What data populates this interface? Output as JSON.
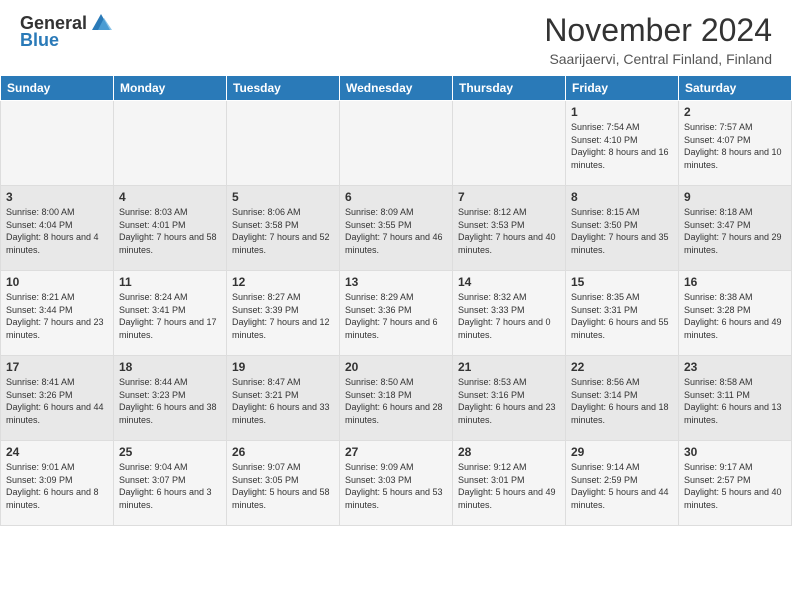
{
  "header": {
    "logo_general": "General",
    "logo_blue": "Blue",
    "month_title": "November 2024",
    "location": "Saarijaervi, Central Finland, Finland"
  },
  "weekdays": [
    "Sunday",
    "Monday",
    "Tuesday",
    "Wednesday",
    "Thursday",
    "Friday",
    "Saturday"
  ],
  "weeks": [
    [
      {
        "day": "",
        "info": ""
      },
      {
        "day": "",
        "info": ""
      },
      {
        "day": "",
        "info": ""
      },
      {
        "day": "",
        "info": ""
      },
      {
        "day": "",
        "info": ""
      },
      {
        "day": "1",
        "info": "Sunrise: 7:54 AM\nSunset: 4:10 PM\nDaylight: 8 hours and 16 minutes."
      },
      {
        "day": "2",
        "info": "Sunrise: 7:57 AM\nSunset: 4:07 PM\nDaylight: 8 hours and 10 minutes."
      }
    ],
    [
      {
        "day": "3",
        "info": "Sunrise: 8:00 AM\nSunset: 4:04 PM\nDaylight: 8 hours and 4 minutes."
      },
      {
        "day": "4",
        "info": "Sunrise: 8:03 AM\nSunset: 4:01 PM\nDaylight: 7 hours and 58 minutes."
      },
      {
        "day": "5",
        "info": "Sunrise: 8:06 AM\nSunset: 3:58 PM\nDaylight: 7 hours and 52 minutes."
      },
      {
        "day": "6",
        "info": "Sunrise: 8:09 AM\nSunset: 3:55 PM\nDaylight: 7 hours and 46 minutes."
      },
      {
        "day": "7",
        "info": "Sunrise: 8:12 AM\nSunset: 3:53 PM\nDaylight: 7 hours and 40 minutes."
      },
      {
        "day": "8",
        "info": "Sunrise: 8:15 AM\nSunset: 3:50 PM\nDaylight: 7 hours and 35 minutes."
      },
      {
        "day": "9",
        "info": "Sunrise: 8:18 AM\nSunset: 3:47 PM\nDaylight: 7 hours and 29 minutes."
      }
    ],
    [
      {
        "day": "10",
        "info": "Sunrise: 8:21 AM\nSunset: 3:44 PM\nDaylight: 7 hours and 23 minutes."
      },
      {
        "day": "11",
        "info": "Sunrise: 8:24 AM\nSunset: 3:41 PM\nDaylight: 7 hours and 17 minutes."
      },
      {
        "day": "12",
        "info": "Sunrise: 8:27 AM\nSunset: 3:39 PM\nDaylight: 7 hours and 12 minutes."
      },
      {
        "day": "13",
        "info": "Sunrise: 8:29 AM\nSunset: 3:36 PM\nDaylight: 7 hours and 6 minutes."
      },
      {
        "day": "14",
        "info": "Sunrise: 8:32 AM\nSunset: 3:33 PM\nDaylight: 7 hours and 0 minutes."
      },
      {
        "day": "15",
        "info": "Sunrise: 8:35 AM\nSunset: 3:31 PM\nDaylight: 6 hours and 55 minutes."
      },
      {
        "day": "16",
        "info": "Sunrise: 8:38 AM\nSunset: 3:28 PM\nDaylight: 6 hours and 49 minutes."
      }
    ],
    [
      {
        "day": "17",
        "info": "Sunrise: 8:41 AM\nSunset: 3:26 PM\nDaylight: 6 hours and 44 minutes."
      },
      {
        "day": "18",
        "info": "Sunrise: 8:44 AM\nSunset: 3:23 PM\nDaylight: 6 hours and 38 minutes."
      },
      {
        "day": "19",
        "info": "Sunrise: 8:47 AM\nSunset: 3:21 PM\nDaylight: 6 hours and 33 minutes."
      },
      {
        "day": "20",
        "info": "Sunrise: 8:50 AM\nSunset: 3:18 PM\nDaylight: 6 hours and 28 minutes."
      },
      {
        "day": "21",
        "info": "Sunrise: 8:53 AM\nSunset: 3:16 PM\nDaylight: 6 hours and 23 minutes."
      },
      {
        "day": "22",
        "info": "Sunrise: 8:56 AM\nSunset: 3:14 PM\nDaylight: 6 hours and 18 minutes."
      },
      {
        "day": "23",
        "info": "Sunrise: 8:58 AM\nSunset: 3:11 PM\nDaylight: 6 hours and 13 minutes."
      }
    ],
    [
      {
        "day": "24",
        "info": "Sunrise: 9:01 AM\nSunset: 3:09 PM\nDaylight: 6 hours and 8 minutes."
      },
      {
        "day": "25",
        "info": "Sunrise: 9:04 AM\nSunset: 3:07 PM\nDaylight: 6 hours and 3 minutes."
      },
      {
        "day": "26",
        "info": "Sunrise: 9:07 AM\nSunset: 3:05 PM\nDaylight: 5 hours and 58 minutes."
      },
      {
        "day": "27",
        "info": "Sunrise: 9:09 AM\nSunset: 3:03 PM\nDaylight: 5 hours and 53 minutes."
      },
      {
        "day": "28",
        "info": "Sunrise: 9:12 AM\nSunset: 3:01 PM\nDaylight: 5 hours and 49 minutes."
      },
      {
        "day": "29",
        "info": "Sunrise: 9:14 AM\nSunset: 2:59 PM\nDaylight: 5 hours and 44 minutes."
      },
      {
        "day": "30",
        "info": "Sunrise: 9:17 AM\nSunset: 2:57 PM\nDaylight: 5 hours and 40 minutes."
      }
    ]
  ]
}
